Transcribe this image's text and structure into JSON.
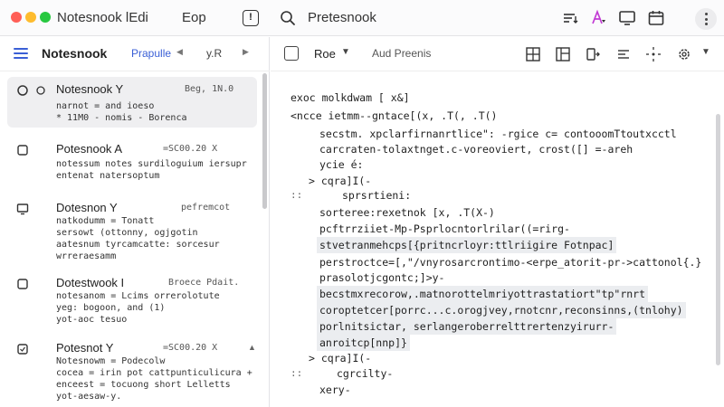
{
  "window": {
    "app_title": "Notesnook lEdi",
    "tab_title": "Eop",
    "search_text": "Pretesnook"
  },
  "sidebar": {
    "title": "Notesnook",
    "filter": "Prapulle",
    "sort": "y.R",
    "notes": [
      {
        "title": "Notesnook Y",
        "meta": "Beg, 1N.0",
        "lines": [
          "narnot = and ioeso",
          "* 11M0 - nomis - Borenca"
        ],
        "active": true
      },
      {
        "title": "Potesnook A",
        "meta": "=SC00.20  X",
        "lines": [
          "notessum notes surdiloguium iersupr",
          "entenat natersoptum"
        ],
        "active": false
      },
      {
        "title": "Dotesnon Y",
        "meta": "pefremcot",
        "lines": [
          "natkodumm = Tonatt",
          "sersowt (ottonny, ogjgotin",
          "aatesnum tyrcamcatte: sorcesur",
          "wrreraesamm"
        ],
        "active": false
      },
      {
        "title": "Dotestwook I",
        "meta": "Broece Pdait.",
        "lines": [
          "notesanom = Lcims orrerolotute",
          "yeg: bogoon, and (1)",
          "yot-aoc tesuo"
        ],
        "active": false
      },
      {
        "title": "Potesnot Y",
        "meta": "=SC00.20  X",
        "lines": [
          "Notesnowm = Podecolw",
          "cocea = irin pot cattpunticulicura +",
          "enceest = tocuong short Lelletts",
          "yot-aesaw-y."
        ],
        "active": false
      }
    ]
  },
  "editor": {
    "mode": "Roe",
    "preview_label": "Aud Preenis",
    "lines": [
      "exoc  molkdwam [ x&]",
      "<ncce ietmm--gntace[(x,  .T(,   .T()",
      "secstm. xpclarfirnanrtlice\":  -rgice c=    contooomTtoutxcctl",
      "carcraten-tolaxtnget.c-voreoviert, crost([] =-areh",
      "ycie é:",
      "> cqra]I(-",
      "sprsrtieni:",
      "sorteree:rexetnok [x,  .T(X-)",
      "pcftrrziiet-Mp-Psprlocntorlrilar((=rirg-",
      "stvetranmehcps[{pritncrloyr:ttlriigire Fotnpac]",
      "perstroctce=[,\"/vnyrosarcrontimo-<erpe_atorit-pr->cattonol{.}",
      "prasolotjcgontc;]>y-",
      "becstmxrecorow,.matnorottelmriyottrastatiort\"tp\"rnrt",
      "coroptetcer[porrc...c.orogjvey,rnotcnr,reconsinns,(tnlohy)",
      "porlnitsictar, serlangeroberrelttrertenzyirurr-",
      "anroitcp[nnp]}",
      "> cqra]I(-",
      "cgrcilty-",
      "xery-"
    ]
  }
}
